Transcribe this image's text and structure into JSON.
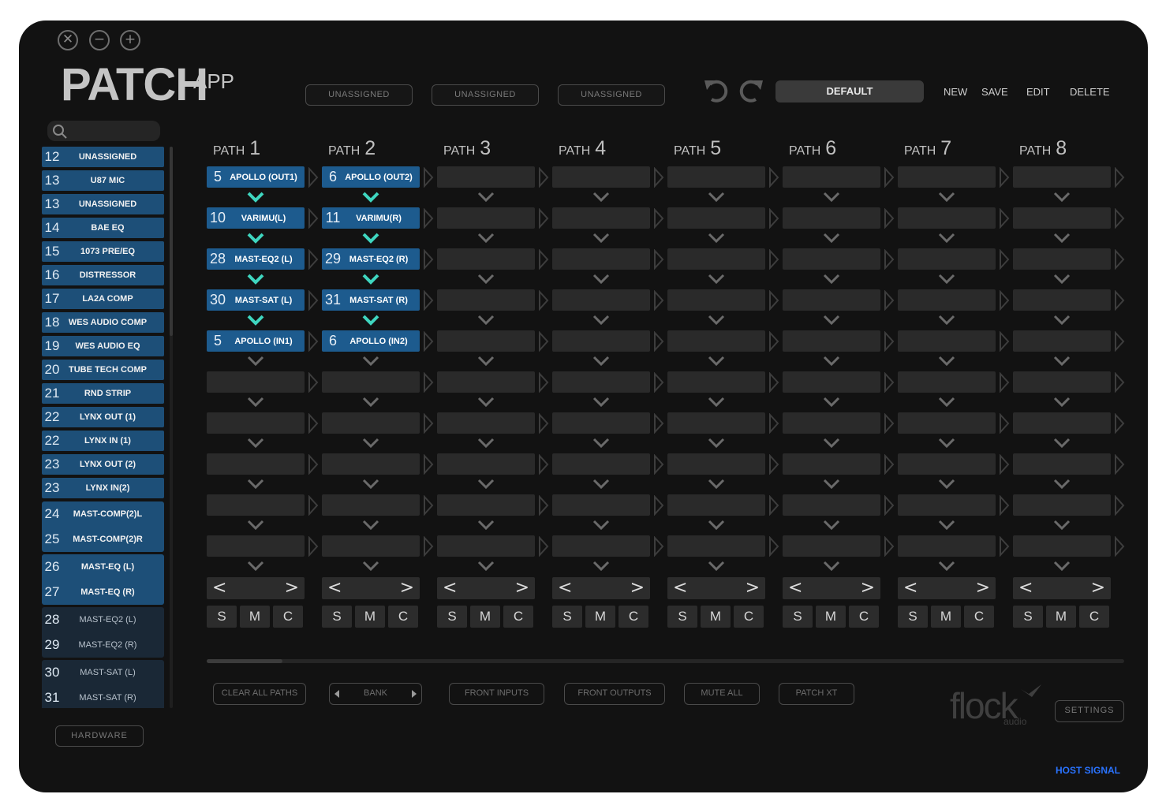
{
  "window_controls": {
    "close": "✕",
    "minimize": "−",
    "maximize": "+"
  },
  "logo": {
    "main": "PATCH",
    "sub": "APP"
  },
  "assign_slots": [
    "UNASSIGNED",
    "UNASSIGNED",
    "UNASSIGNED"
  ],
  "preset": {
    "name": "DEFAULT",
    "actions": [
      "NEW",
      "SAVE",
      "EDIT",
      "DELETE"
    ]
  },
  "search": {
    "placeholder": ""
  },
  "sidebar": {
    "items": [
      {
        "num": "12",
        "label": "UNASSIGNED",
        "style": "blue"
      },
      {
        "num": "13",
        "label": "U87 MIC",
        "style": "blue"
      },
      {
        "num": "13",
        "label": "UNASSIGNED",
        "style": "blue"
      },
      {
        "num": "14",
        "label": "BAE EQ",
        "style": "blue"
      },
      {
        "num": "15",
        "label": "1073 PRE/EQ",
        "style": "blue"
      },
      {
        "num": "16",
        "label": "DISTRESSOR",
        "style": "blue"
      },
      {
        "num": "17",
        "label": "LA2A COMP",
        "style": "blue"
      },
      {
        "num": "18",
        "label": "WES AUDIO COMP",
        "style": "blue"
      },
      {
        "num": "19",
        "label": "WES AUDIO EQ",
        "style": "blue"
      },
      {
        "num": "20",
        "label": "TUBE TECH COMP",
        "style": "blue"
      },
      {
        "num": "21",
        "label": "RND STRIP",
        "style": "blue"
      },
      {
        "num": "22",
        "label": "LYNX OUT (1)",
        "style": "blue"
      },
      {
        "num": "22",
        "label": "LYNX IN (1)",
        "style": "blue"
      },
      {
        "num": "23",
        "label": "LYNX OUT (2)",
        "style": "blue"
      },
      {
        "num": "23",
        "label": "LYNX IN(2)",
        "style": "blue"
      }
    ],
    "groups": [
      {
        "style": "blue",
        "items": [
          {
            "num": "24",
            "label": "MAST-COMP(2)L"
          },
          {
            "num": "25",
            "label": "MAST-COMP(2)R"
          }
        ]
      },
      {
        "style": "blue",
        "items": [
          {
            "num": "26",
            "label": "MAST-EQ (L)"
          },
          {
            "num": "27",
            "label": "MAST-EQ (R)"
          }
        ]
      },
      {
        "style": "dark",
        "items": [
          {
            "num": "28",
            "label": "MAST-EQ2 (L)"
          },
          {
            "num": "29",
            "label": "MAST-EQ2 (R)"
          }
        ]
      },
      {
        "style": "dark",
        "items": [
          {
            "num": "30",
            "label": "MAST-SAT (L)"
          },
          {
            "num": "31",
            "label": "MAST-SAT (R)"
          }
        ]
      }
    ],
    "hardware_label": "HARDWARE"
  },
  "paths": {
    "word": "PATH",
    "numbers": [
      "1",
      "2",
      "3",
      "4",
      "5",
      "6",
      "7",
      "8"
    ],
    "rows": 10,
    "filled": [
      [
        {
          "num": "5",
          "label": "APOLLO (OUT1)"
        },
        {
          "num": "10",
          "label": "VARIMU(L)"
        },
        {
          "num": "28",
          "label": "MAST-EQ2 (L)"
        },
        {
          "num": "30",
          "label": "MAST-SAT (L)"
        },
        {
          "num": "5",
          "label": "APOLLO (IN1)"
        }
      ],
      [
        {
          "num": "6",
          "label": "APOLLO (OUT2)"
        },
        {
          "num": "11",
          "label": "VARIMU(R)"
        },
        {
          "num": "29",
          "label": "MAST-EQ2 (R)"
        },
        {
          "num": "31",
          "label": "MAST-SAT (R)"
        },
        {
          "num": "6",
          "label": "APOLLO (IN2)"
        }
      ],
      [],
      [],
      [],
      [],
      [],
      []
    ],
    "pager": {
      "prev": "<",
      "next": ">"
    },
    "smc": [
      "S",
      "M",
      "C"
    ]
  },
  "colors": {
    "accent_teal": "#3fd6c0",
    "slot_blue": "#1d5b8e",
    "host_signal": "#2a73ff"
  },
  "bottom_buttons": {
    "clear_all": "CLEAR ALL PATHS",
    "bank": "BANK",
    "front_inputs": "FRONT INPUTS",
    "front_outputs": "FRONT OUTPUTS",
    "mute_all": "MUTE ALL",
    "patch_xt": "PATCH XT"
  },
  "brand": {
    "name": "flock",
    "sub": "audio"
  },
  "settings_label": "SETTINGS",
  "host_signal": "HOST SIGNAL"
}
